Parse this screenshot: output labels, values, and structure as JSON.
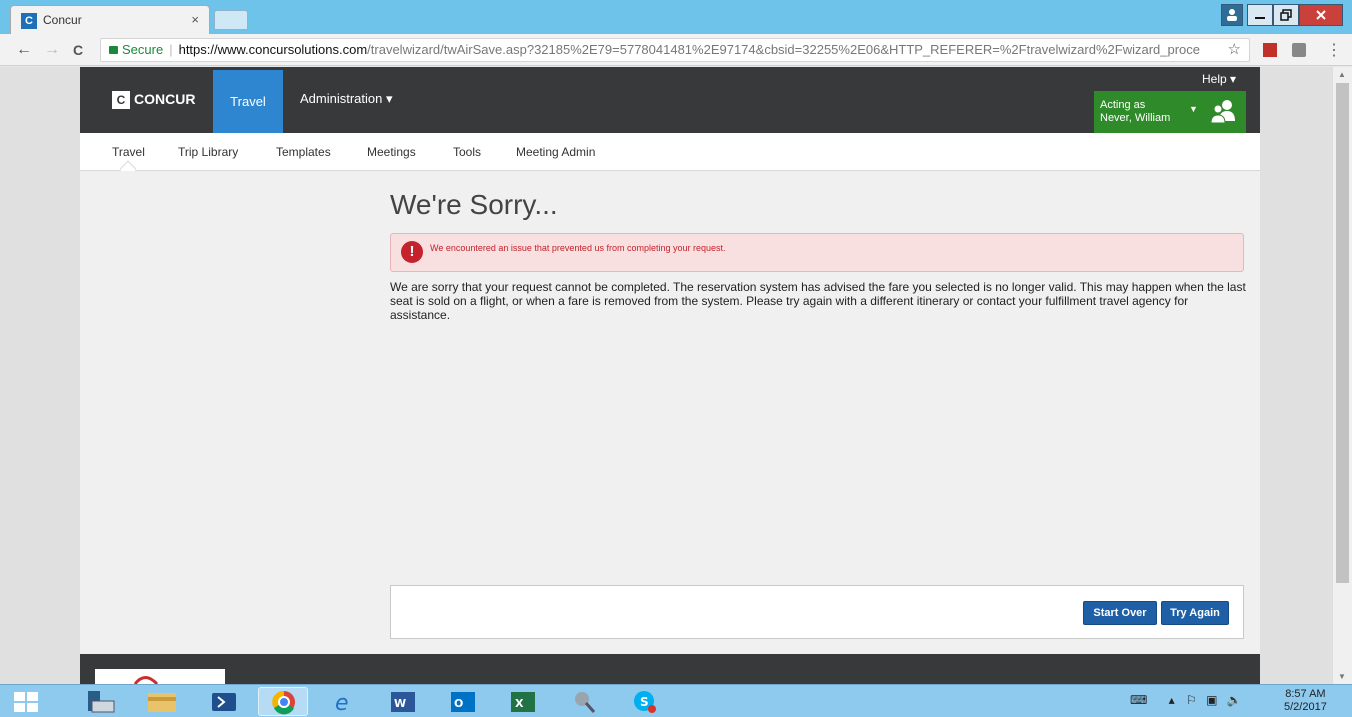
{
  "browser": {
    "tab_title": "Concur",
    "tab_close": "×",
    "secure_label": "Secure",
    "url_host": "https://www.concursolutions.com",
    "url_path": "/travelwizard/twAirSave.asp?32185%2E79=5778041481%2E97174&cbsid=32255%2E06&HTTP_REFERER=%2Ftravelwizard%2Fwizard_proce",
    "back_glyph": "←",
    "forward_glyph": "→",
    "reload_glyph": "C",
    "star_glyph": "☆",
    "menu_glyph": "⋮",
    "icons": [
      "favicon-concur",
      "user-icon",
      "minimize-icon",
      "maximize-icon",
      "close-icon",
      "lock-icon",
      "star-icon",
      "pdf-icon",
      "extension-icon"
    ]
  },
  "topnav": {
    "logo_mark": "C",
    "logo_text": "CONCUR",
    "travel": "Travel",
    "administration": "Administration ▾",
    "help": "Help ▾",
    "acting_label": "Acting as",
    "acting_name": "Never, William",
    "acting_caret": "▼"
  },
  "subnav": {
    "items": [
      "Travel",
      "Trip Library",
      "Templates",
      "Meetings",
      "Tools",
      "Meeting Admin"
    ]
  },
  "main": {
    "heading": "We're Sorry...",
    "alert_icon": "!",
    "alert_text": "We encountered an issue that prevented us from completing your request.",
    "body_text": "We are sorry that your request cannot be completed. The reservation system has advised the fare you selected is no longer valid. This may happen when the last seat is sold on a flight, or when a fare is removed from the system. Please try again with a different itinerary or contact your fulfillment travel agency for assistance.",
    "start_over": "Start Over",
    "try_again": "Try Again"
  },
  "taskbar": {
    "time": "8:57 AM",
    "date": "5/2/2017",
    "apps": [
      "windows-start-icon",
      "server-manager-icon",
      "file-explorer-icon",
      "powershell-icon",
      "chrome-icon",
      "ie-icon",
      "word-icon",
      "outlook-icon",
      "excel-icon",
      "tool-icon",
      "skype-icon"
    ]
  },
  "colors": {
    "nav_dark": "#37393b",
    "nav_active": "#2f86d0",
    "acting_green": "#2f8a2a",
    "alert_bg": "#f8dfe0",
    "alert_red": "#c4232e",
    "button_blue": "#1f5fa5"
  }
}
